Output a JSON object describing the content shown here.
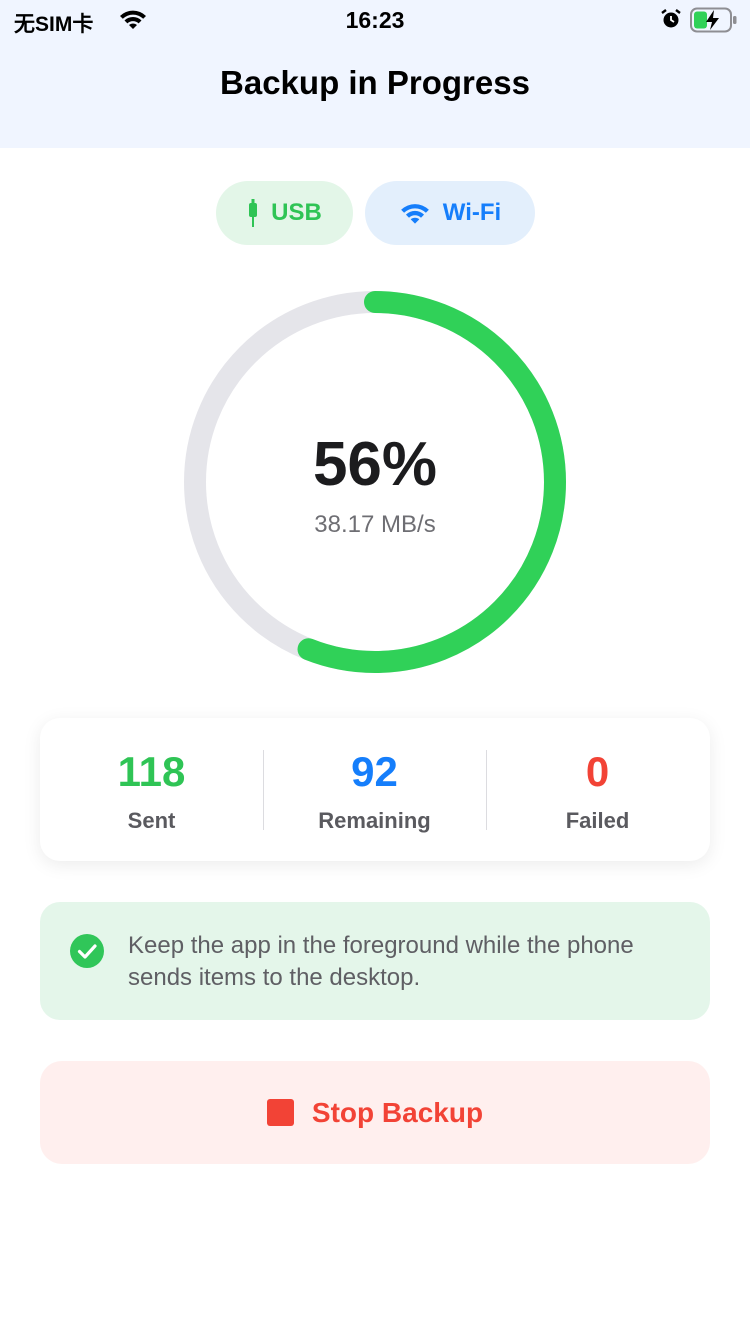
{
  "status_bar": {
    "carrier": "无SIM卡",
    "time": "16:23"
  },
  "header": {
    "title": "Backup in Progress"
  },
  "connections": [
    {
      "label": "USB",
      "icon": "usb-plug-icon",
      "color": "#2fc455"
    },
    {
      "label": "Wi-Fi",
      "icon": "wifi-icon",
      "color": "#157efb"
    }
  ],
  "progress": {
    "percent_label": "56%",
    "fraction": 0.56,
    "speed": "38.17 MB/s",
    "color": "#30d158",
    "track_color": "#e5e5ea"
  },
  "stats": [
    {
      "value": "118",
      "label": "Sent",
      "color": "#2fc455"
    },
    {
      "value": "92",
      "label": "Remaining",
      "color": "#157efb"
    },
    {
      "value": "0",
      "label": "Failed",
      "color": "#f24336"
    }
  ],
  "notice": {
    "icon": "check-circle-icon",
    "text": "Keep the app in the foreground while the phone sends items to the desktop."
  },
  "stop_button": {
    "icon": "stop-square-icon",
    "label": "Stop Backup",
    "color": "#f24336"
  }
}
